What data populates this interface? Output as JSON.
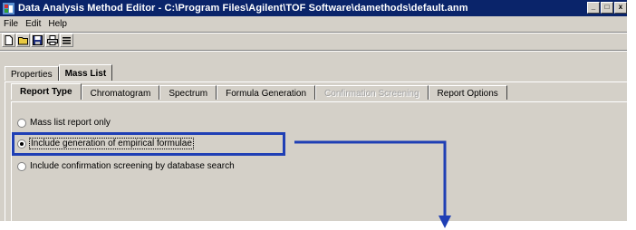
{
  "window": {
    "title": "Data Analysis Method Editor - C:\\Program Files\\Agilent\\TOF Software\\damethods\\default.anm",
    "caption_buttons": [
      "_",
      "□",
      "x"
    ]
  },
  "menu": [
    "File",
    "Edit",
    "Help"
  ],
  "toolbar": {
    "icons": [
      "new-icon",
      "open-icon",
      "save-icon",
      "print-icon",
      "properties-icon"
    ]
  },
  "outer_tabs": [
    {
      "label": "Properties",
      "active": false
    },
    {
      "label": "Mass List",
      "active": true
    }
  ],
  "inner_tabs": [
    {
      "label": "Report Type",
      "active": true
    },
    {
      "label": "Chromatogram",
      "active": false
    },
    {
      "label": "Spectrum",
      "active": false
    },
    {
      "label": "Formula Generation",
      "active": false
    },
    {
      "label": "Confirmation Screening",
      "active": false,
      "disabled": true
    },
    {
      "label": "Report Options",
      "active": false
    }
  ],
  "report_type_options": [
    {
      "label": "Mass list report only",
      "selected": false
    },
    {
      "label": "Include generation of empirical formulae",
      "selected": true
    },
    {
      "label": "Include confirmation screening by database search",
      "selected": false
    }
  ],
  "colors": {
    "titlebar": "#0a246a",
    "highlight": "#1f3fb5",
    "window_face": "#d4d0c8"
  }
}
